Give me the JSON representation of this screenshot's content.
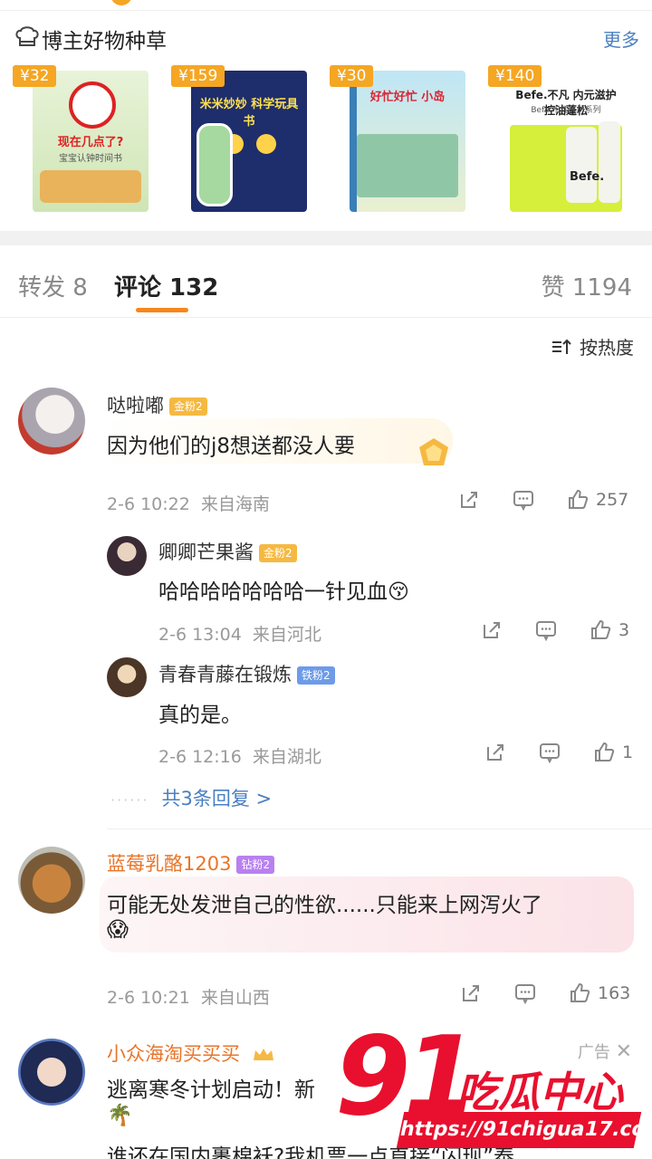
{
  "products_section": {
    "title": "博主好物种草",
    "more": "更多",
    "items": [
      {
        "price": "¥32",
        "cover_text": "现在几点了?",
        "cover_sub": "宝宝认钟时间书"
      },
      {
        "price": "¥159",
        "cover_text": "米米妙妙 科学玩具书"
      },
      {
        "price": "¥30",
        "cover_text": "好忙好忙 小岛"
      },
      {
        "price": "¥140",
        "cover_text": "Befe.不凡 内元滋护 控油蓬松",
        "cover_sub": "Befe.不凡洗护系列",
        "brand_label": "Befe."
      }
    ]
  },
  "tabs": {
    "repost": "转发 8",
    "comments": "评论 132",
    "likes": "赞 1194"
  },
  "sort": {
    "label": "按热度"
  },
  "comments": [
    {
      "user": "哒啦嘟",
      "badge": "金粉2",
      "text": "因为他们的j8想送都没人要",
      "time": "2-6 10:22",
      "location": "来自海南",
      "likes": "257",
      "replies": [
        {
          "user": "卿卿芒果酱",
          "badge": "金粉2",
          "text": "哈哈哈哈哈哈哈一针见血😚",
          "time": "2-6 13:04",
          "location": "来自河北",
          "likes": "3"
        },
        {
          "user": "青春青藤在锻炼",
          "badge": "铁粉2",
          "text": "真的是。",
          "time": "2-6 12:16",
          "location": "来自湖北",
          "likes": "1"
        }
      ],
      "more_replies": "共3条回复 >"
    },
    {
      "user": "蓝莓乳酪1203",
      "badge": "钻粉2",
      "text": "可能无处发泄自己的性欲......只能来上网泻火了",
      "emoji": "😱",
      "time": "2-6 10:21",
      "location": "来自山西",
      "likes": "163"
    },
    {
      "user": "小众海淘买买买",
      "ad_label": "广告",
      "text_line1": "逃离寒冬计划启动！新",
      "emoji": "🌴",
      "text_line2": "谁还在国内裹棉袄?我机票一点直接“闪现”泰"
    }
  ],
  "watermark": {
    "number": "91",
    "name": "吃瓜中心",
    "url": "https://91chigua17.com"
  },
  "colors": {
    "accent_orange": "#f7861b",
    "price_tag": "#f5a623",
    "link_blue": "#4a7fc0",
    "watermark_red": "#e8102e"
  }
}
